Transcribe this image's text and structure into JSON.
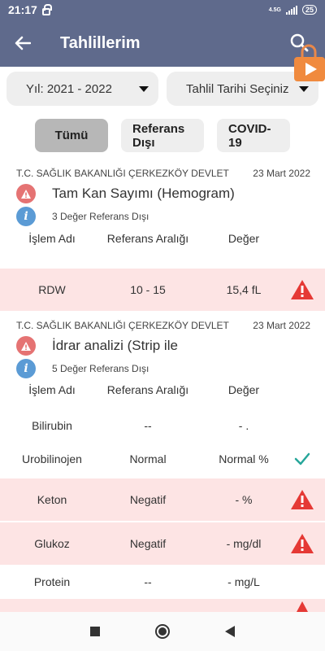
{
  "status_bar": {
    "time": "21:17",
    "network": "4.5G",
    "battery": "25"
  },
  "app_bar": {
    "title": "Tahlillerim"
  },
  "filters": {
    "year": "Yıl: 2021 - 2022",
    "date": "Tahlil Tarihi Seçiniz"
  },
  "chips": [
    {
      "label": "Tümü"
    },
    {
      "label": "Referans Dışı"
    },
    {
      "label": "COVID-19"
    }
  ],
  "columns": {
    "name": "İşlem Adı",
    "range": "Referans Aralığı",
    "value": "Değer"
  },
  "tests": [
    {
      "hospital": "T.C. SAĞLIK BAKANLIĞI ÇERKEZKÖY DEVLET",
      "date": "23 Mart 2022",
      "name": "Tam Kan Sayımı (Hemogram)",
      "out_of_range": "3 Değer Referans Dışı",
      "rows": [
        {
          "name": "RDW",
          "range": "10 - 15",
          "value": "15,4 fL",
          "status": "warning"
        }
      ]
    },
    {
      "hospital": "T.C. SAĞLIK BAKANLIĞI ÇERKEZKÖY DEVLET",
      "date": "23 Mart 2022",
      "name": "İdrar analizi (Strip ile",
      "out_of_range": "5 Değer Referans Dışı",
      "rows": [
        {
          "name": "Bilirubin",
          "range": "--",
          "value": "- .",
          "status": "none"
        },
        {
          "name": "Urobilinojen",
          "range": "Normal",
          "value": "Normal %",
          "status": "ok"
        },
        {
          "name": "Keton",
          "range": "Negatif",
          "value": "- %",
          "status": "warning"
        },
        {
          "name": "Glukoz",
          "range": "Negatif",
          "value": "- mg/dl",
          "status": "warning"
        },
        {
          "name": "Protein",
          "range": "--",
          "value": "- mg/L",
          "status": "none"
        }
      ]
    }
  ],
  "colors": {
    "app_bar": "#5f6a8c",
    "warning": "#e53935",
    "ok": "#26a69a",
    "pink_row": "#fde4e4"
  }
}
